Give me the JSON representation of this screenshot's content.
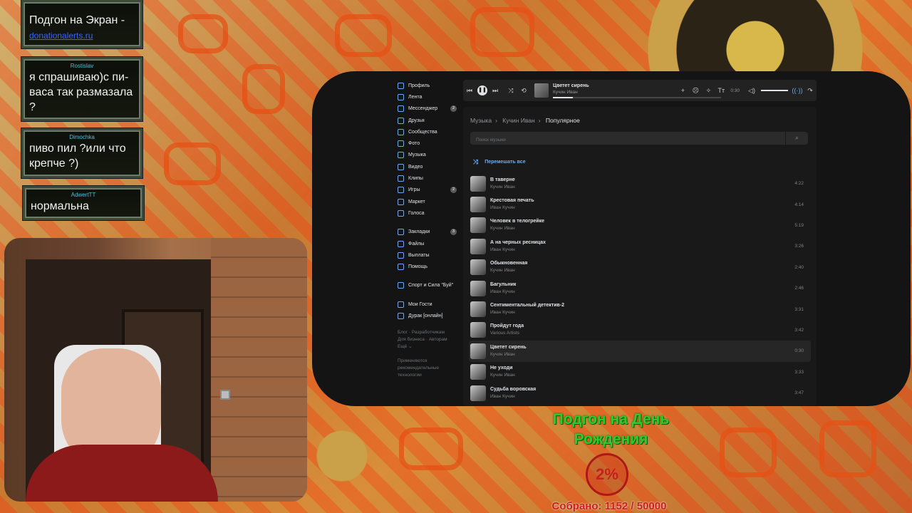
{
  "chat": [
    {
      "name": "",
      "text": "Подгон на Экран -",
      "link": "donationalerts.ru"
    },
    {
      "name": "Rostislav",
      "text": "я спрашиваю)с пи-васа так размазала ?"
    },
    {
      "name": "Dimochka",
      "text": "пиво пил ?или что крепче ?)"
    },
    {
      "name": "AdwertTT",
      "text": "нормальна"
    }
  ],
  "sidebar": {
    "items": [
      {
        "label": "Профиль",
        "badge": ""
      },
      {
        "label": "Лента",
        "badge": ""
      },
      {
        "label": "Мессенджер",
        "badge": "2"
      },
      {
        "label": "Друзья",
        "badge": ""
      },
      {
        "label": "Сообщества",
        "badge": ""
      },
      {
        "label": "Фото",
        "badge": ""
      },
      {
        "label": "Музыка",
        "badge": ""
      },
      {
        "label": "Видео",
        "badge": ""
      },
      {
        "label": "Клипы",
        "badge": ""
      },
      {
        "label": "Игры",
        "badge": "2"
      },
      {
        "label": "Маркет",
        "badge": ""
      },
      {
        "label": "Голоса",
        "badge": ""
      }
    ],
    "items2": [
      {
        "label": "Закладки",
        "badge": "3"
      },
      {
        "label": "Файлы",
        "badge": ""
      },
      {
        "label": "Выплаты",
        "badge": ""
      },
      {
        "label": "Помощь",
        "badge": ""
      }
    ],
    "group": "Спорт и Сила \"Буй\"",
    "items3": [
      {
        "label": "Мои Гости"
      },
      {
        "label": "Дурак [онлайн]"
      }
    ],
    "footer_line1": "Блог · Разработчикам",
    "footer_line2": "Для бизнеса · Авторам",
    "footer_line3": "Ещё ⌄",
    "footer_note": "Применяются рекомендательные технологии"
  },
  "player": {
    "title": "Цветет сирень",
    "artist": "Кучин Иван",
    "time": "0:30",
    "progress": 0.12
  },
  "breadcrumb": {
    "a": "Музыка",
    "b": "Кучин Иван",
    "c": "Популярное"
  },
  "search": {
    "placeholder": "Поиск музыки"
  },
  "shuffle_all": "Перемешать все",
  "tracks": [
    {
      "title": "В таверне",
      "artist": "Кучин Иван",
      "duration": "4:22"
    },
    {
      "title": "Крестовая печать",
      "artist": "Иван Кучин",
      "duration": "4:14"
    },
    {
      "title": "Человек в телогрейке",
      "artist": "Кучин Иван",
      "duration": "5:19"
    },
    {
      "title": "А на черных ресницах",
      "artist": "Иван Кучин",
      "duration": "3:26"
    },
    {
      "title": "Обыкновенная",
      "artist": "Кучин Иван",
      "duration": "2:40"
    },
    {
      "title": "Багульник",
      "artist": "Иван Кучин",
      "duration": "2:46"
    },
    {
      "title": "Сентиментальный детектив-2",
      "artist": "Иван Кучин",
      "duration": "3:31"
    },
    {
      "title": "Пройдут года",
      "artist": "Various Artists",
      "duration": "3:42"
    },
    {
      "title": "Цветет сирень",
      "artist": "Кучин Иван",
      "duration": "0:30",
      "active": true
    },
    {
      "title": "Не уходи",
      "artist": "Кучин Иван",
      "duration": "3:33"
    },
    {
      "title": "Судьба воровская",
      "artist": "Иван Кучин",
      "duration": "3:47"
    }
  ],
  "overlay": {
    "goal_title_1": "Подгон на День",
    "goal_title_2": "Рождения",
    "percent": "2%",
    "collected": "Собрано: 1152 / 50000"
  }
}
